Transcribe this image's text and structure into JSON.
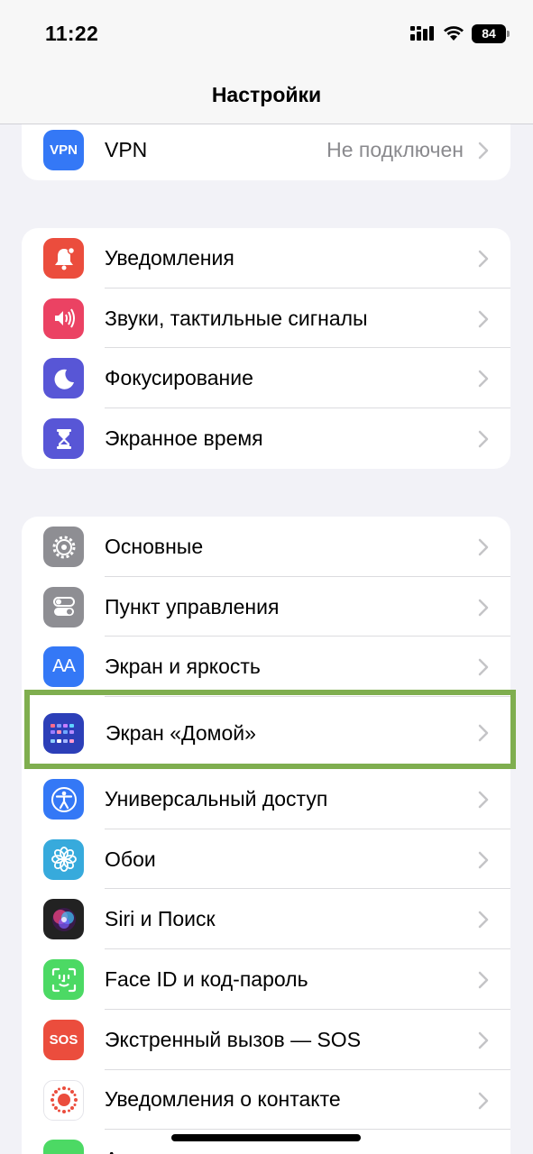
{
  "status_bar": {
    "time": "11:22",
    "battery": "84"
  },
  "nav": {
    "title": "Настройки"
  },
  "vpn_group": {
    "items": [
      {
        "label": "VPN",
        "value": "Не подключен",
        "icon": "vpn-icon",
        "icon_text": "VPN",
        "color": "#3478f6"
      }
    ]
  },
  "group1": {
    "items": [
      {
        "label": "Уведомления",
        "icon": "bell-icon",
        "color": "#eb4d3d"
      },
      {
        "label": "Звуки, тактильные сигналы",
        "icon": "speaker-icon",
        "color": "#eb4263"
      },
      {
        "label": "Фокусирование",
        "icon": "moon-icon",
        "color": "#5856d6"
      },
      {
        "label": "Экранное время",
        "icon": "hourglass-icon",
        "color": "#5856d6"
      }
    ]
  },
  "group2": {
    "items": [
      {
        "label": "Основные",
        "icon": "gear-icon",
        "color": "#8e8e93"
      },
      {
        "label": "Пункт управления",
        "icon": "toggles-icon",
        "color": "#8e8e93"
      },
      {
        "label": "Экран и яркость",
        "icon": "text-size-icon",
        "icon_text": "AA",
        "color": "#3478f6"
      },
      {
        "label": "Экран «Домой»",
        "icon": "home-screen-icon",
        "color": "#2c3fb8",
        "highlighted": true
      },
      {
        "label": "Универсальный доступ",
        "icon": "accessibility-icon",
        "color": "#3478f6"
      },
      {
        "label": "Обои",
        "icon": "flower-icon",
        "color": "#37aadc"
      },
      {
        "label": "Siri и Поиск",
        "icon": "siri-icon",
        "color": "#222222"
      },
      {
        "label": "Face ID и код-пароль",
        "icon": "face-id-icon",
        "color": "#4cd964"
      },
      {
        "label": "Экстренный вызов — SOS",
        "icon": "sos-icon",
        "icon_text": "SOS",
        "color": "#eb4d3d"
      },
      {
        "label": "Уведомления о контакте",
        "icon": "exposure-icon",
        "color": "#ffffff"
      },
      {
        "label": "А",
        "icon": "battery-icon",
        "color": "#4cd964"
      }
    ]
  }
}
